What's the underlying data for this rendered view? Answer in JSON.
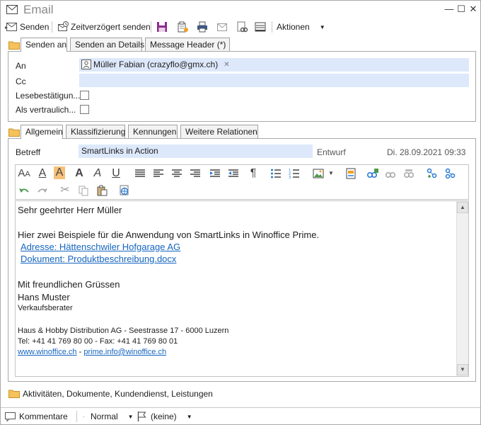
{
  "window": {
    "title": "Email",
    "controls": {
      "minimize": "—",
      "maximize": "☐",
      "close": "✕"
    }
  },
  "toolbar": {
    "send_label": "Senden",
    "delayed_send_label": "Zeitverzögert senden",
    "actions_label": "Aktionen",
    "icons": [
      "save-icon",
      "attach-icon",
      "print-icon",
      "mail-icon",
      "link-icon",
      "scanner-icon"
    ]
  },
  "recipient_tabs": {
    "tabs": [
      "Senden an",
      "Senden an Details",
      "Message Header (*)"
    ],
    "active": "Senden an"
  },
  "recipients": {
    "to_label": "An",
    "to_value": "Müller Fabian (crazyflo@gmx.ch)",
    "cc_label": "Cc",
    "cc_value": "",
    "read_receipt_label": "Lesebestätigun...",
    "confidential_label": "Als  vertraulich..."
  },
  "detail_tabs": {
    "tabs": [
      "Allgemein",
      "Klassifizierung",
      "Kennungen",
      "Weitere Relationen"
    ],
    "active": "Allgemein"
  },
  "general": {
    "subject_label": "Betreff",
    "subject_value": "SmartLinks in Action",
    "state": "Entwurf",
    "date": "Di. 28.09.2021 09:33"
  },
  "body": {
    "salutation": "Sehr geehrter Herr Müller",
    "intro": "Hier zwei Beispiele für die Anwendung von SmartLinks in Winoffice Prime.",
    "link1": "Adresse: Hättenschwiler Hofgarage AG",
    "link2": "Dokument: Produktbeschreibung.docx",
    "closing": "Mit freundlichen Grüssen",
    "sender_name": "Hans Muster",
    "sender_title": "Verkaufsberater",
    "company_line": "Haus & Hobby Distribution AG - Seestrasse 17 - 6000 Luzern",
    "phone_line": "Tel: +41 41 769 80 00 - Fax: +41 41 769 80 01",
    "web_link": "www.winoffice.ch",
    "separator": "-",
    "mail_link": "prime.info@winoffice.ch"
  },
  "section_footer": {
    "label": "Aktivitäten, Dokumente, Kundendienst, Leistungen"
  },
  "statusbar": {
    "comments_label": "Kommentare",
    "priority_value": "Normal",
    "flag_value": "(keine)"
  },
  "colors": {
    "field_bg": "#dde8fb",
    "link": "#1565c0",
    "folder": "#f5c35a"
  }
}
